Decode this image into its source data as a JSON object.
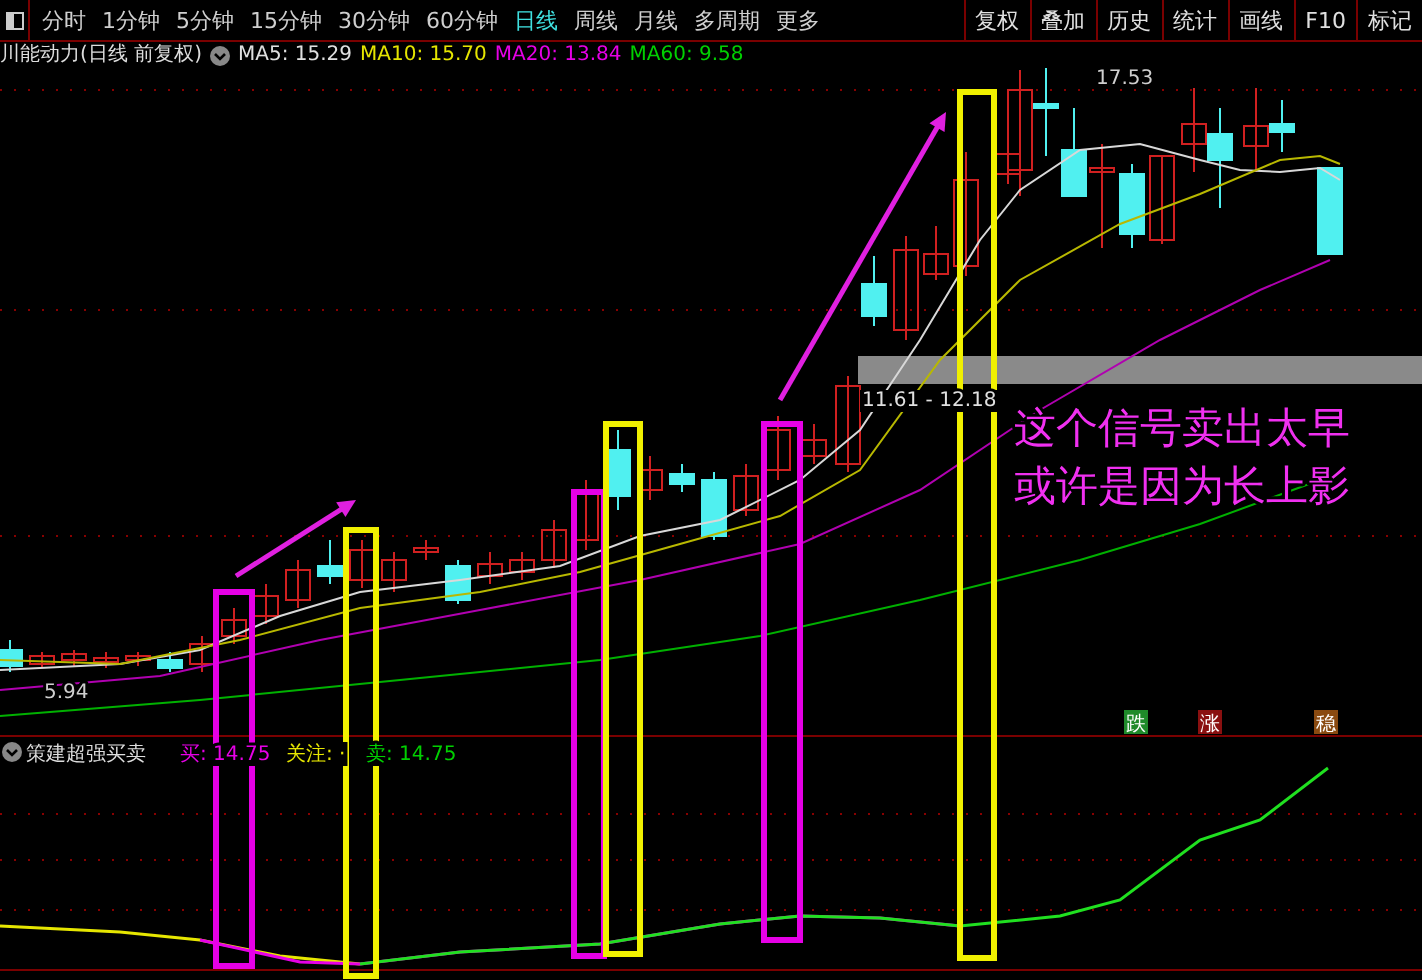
{
  "toolbar": {
    "periods": [
      {
        "label": "分时",
        "selected": false
      },
      {
        "label": "1分钟",
        "selected": false
      },
      {
        "label": "5分钟",
        "selected": false
      },
      {
        "label": "15分钟",
        "selected": false
      },
      {
        "label": "30分钟",
        "selected": false
      },
      {
        "label": "60分钟",
        "selected": false
      },
      {
        "label": "日线",
        "selected": true
      },
      {
        "label": "周线",
        "selected": false
      },
      {
        "label": "月线",
        "selected": false
      },
      {
        "label": "多周期",
        "selected": false
      },
      {
        "label": "更多",
        "selected": false
      }
    ],
    "buttons": [
      "复权",
      "叠加",
      "历史",
      "统计",
      "画线",
      "F10",
      "标记"
    ]
  },
  "legend": {
    "title": "川能动力(日线 前复权)",
    "averages": [
      {
        "label": "MA5: 15.29",
        "color": "#e0e0e0"
      },
      {
        "label": "MA10: 15.70",
        "color": "#e6e600"
      },
      {
        "label": "MA20: 13.84",
        "color": "#e600e6"
      },
      {
        "label": "MA60: 9.58",
        "color": "#00d000"
      }
    ]
  },
  "chart": {
    "high_label": "17.53",
    "low_label": "5.94",
    "range_label": "11.61 - 12.18",
    "annotation": [
      "这个信号卖出太早",
      "或许是因为长上影"
    ]
  },
  "indicator": {
    "name": "策建超强买卖",
    "fields": [
      {
        "label": "买: 14.75",
        "color": "#e600e6"
      },
      {
        "label": "关注: ·",
        "color": "#e6e600"
      },
      {
        "label": "卖: 14.75",
        "color": "#00d000"
      }
    ],
    "badges": [
      {
        "label": "跌",
        "color": "#1f8a2a"
      },
      {
        "label": "涨",
        "color": "#8a1010"
      },
      {
        "label": "稳",
        "color": "#8a4a10"
      }
    ]
  }
}
